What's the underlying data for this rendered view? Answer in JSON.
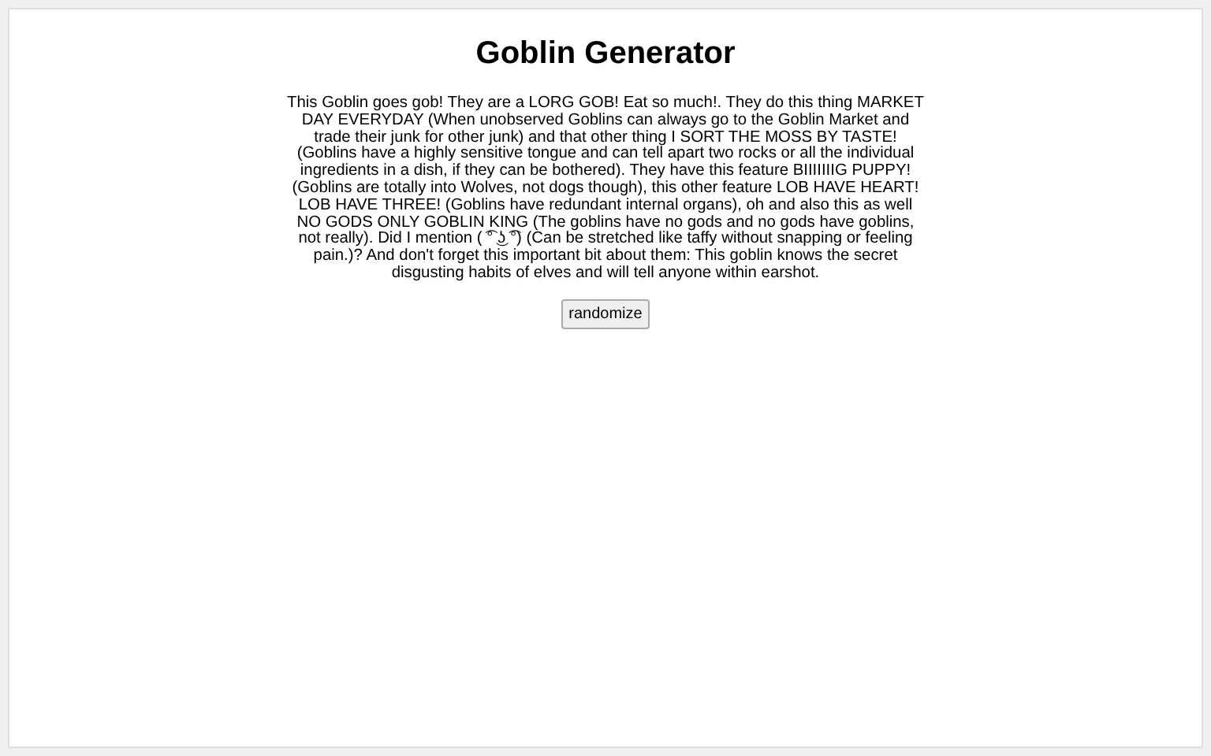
{
  "title": "Goblin Generator",
  "description": "This Goblin goes gob! They are a LORG GOB! Eat so much!. They do this thing MARKET DAY EVERYDAY (When unobserved Goblins can always go to the Goblin Market and trade their junk for other junk) and that other thing I SORT THE MOSS BY TASTE! (Goblins have a highly sensitive tongue and can tell apart two rocks or all the individual ingredients in a dish, if they can be bothered). They have this feature BIIIIIIIG PUPPY! (Goblins are totally into Wolves, not dogs though), this other feature LOB HAVE HEART! LOB HAVE THREE! (Goblins have redundant internal organs), oh and also this as well NO GODS ONLY GOBLIN KING (The goblins have no gods and no gods have goblins, not really). Did I mention ( ͡° ͜ʖ ͡°) (Can be stretched like taffy without snapping or feeling pain.)? And don't forget this important bit about them: This goblin knows the secret disgusting habits of elves and will tell anyone within earshot.",
  "button": "randomize"
}
